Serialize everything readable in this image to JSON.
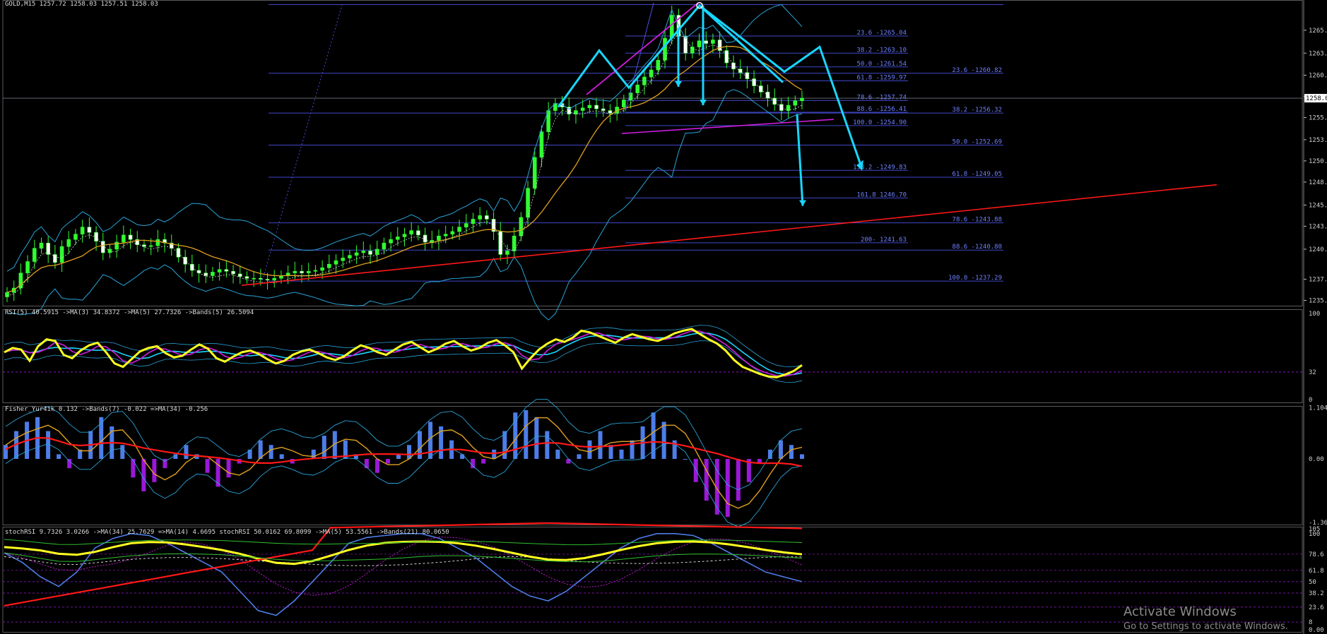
{
  "symbol_label": "GOLD,M15 1257.72 1258.03 1257.51 1258.03",
  "colors": {
    "background": "#000000",
    "grid": "#2b2f7a",
    "fib": "#3f48c8",
    "fib_text": "#6f80ff",
    "cyan": "#19d6ff",
    "magenta": "#d01ee0",
    "red": "#ff1818",
    "yellow": "#ffff20",
    "orange": "#e0a020",
    "blue_hist": "#4e7de8",
    "purple_hist": "#9a18d8",
    "price_axis": "#d0d0d0",
    "bull": "#30ff30",
    "bear": "#ffffff"
  },
  "price_panel": {
    "ylim": [
      1234.5,
      1268.8
    ],
    "axis_ticks": [
      "1265.7",
      "1263.1",
      "1260.6",
      "1258.2",
      "1255.8",
      "1253.3",
      "1250.9",
      "1248.5",
      "1245.9",
      "1243.5",
      "1240.9",
      "1237.5",
      "1235.1"
    ],
    "current_price": "1258.0",
    "fib_labels": [
      {
        "text": "23.6 -1265.04",
        "v": 1265.04
      },
      {
        "text": "38.2 -1263.10",
        "v": 1263.1
      },
      {
        "text": "50.0 -1261.54",
        "v": 1261.54
      },
      {
        "text": "61.8 -1259.97",
        "v": 1259.97
      },
      {
        "text": "78.6 -1257.74",
        "v": 1257.74
      },
      {
        "text": "88.6 -1256.41",
        "v": 1256.41
      },
      {
        "text": "100.0 -1254.90",
        "v": 1254.9
      },
      {
        "text": "138.2 -1249.83",
        "v": 1249.83
      },
      {
        "text": "161.8 1246.70",
        "v": 1246.7
      },
      {
        "text": "200- 1241.63",
        "v": 1241.63
      },
      {
        "text": "23.6 -1260.82",
        "v": 1260.82
      },
      {
        "text": "38.2 -1256.32",
        "v": 1256.32
      },
      {
        "text": "50.0 -1252.69",
        "v": 1252.69
      },
      {
        "text": "61.8 -1249.05",
        "v": 1249.05
      },
      {
        "text": "78.6 -1243.88",
        "v": 1243.88
      },
      {
        "text": "88.6 -1240.80",
        "v": 1240.8
      },
      {
        "text": "100.0 -1237.29",
        "v": 1237.29
      }
    ]
  },
  "rsi_panel": {
    "label": "RSI(5) 40.5915  ->MA(3) 34.8372  ->MA(5) 27.7326  ->Bands(5) 26.5094",
    "axis_ticks": [
      "100",
      "32",
      "0"
    ]
  },
  "fisher_panel": {
    "label": "Fisher_Yur4ik 0.132  ->Bands(7) -0.022  =>MA(34) -0.256",
    "axis_ticks": [
      "1.104",
      "0.00",
      "-1.369"
    ]
  },
  "stoch_panel": {
    "label": "stochRSI 9.7326 3.0266  ->MA(34) 25.7629  =>MA(14) 4.6695  stochRSI 50.0162 69.8099  ->MA(5) 53.5561  ->Bands(21) 80.0650",
    "axis_ticks": [
      "105",
      "100",
      "78.6",
      "61.8",
      "50",
      "38.2",
      "23.6",
      "8",
      "0.00"
    ]
  },
  "watermark": {
    "line1": "Activate Windows",
    "line2": "Go to Settings to activate Windows."
  },
  "chart_data": {
    "type": "line",
    "title": "",
    "xlabel": "",
    "ylabel": "",
    "ylim": [
      1234.5,
      1268.8
    ],
    "series": [
      {
        "values": [
          1236.0,
          1236.5,
          1238.2,
          1239.5,
          1241.0,
          1241.6,
          1240.3,
          1239.4,
          1241.2,
          1242.0,
          1242.6,
          1243.4,
          1242.8,
          1241.8,
          1240.5,
          1240.9,
          1241.7,
          1242.5,
          1242.0,
          1241.4,
          1241.2,
          1241.3,
          1242.0,
          1241.6,
          1241.0,
          1240.0,
          1239.2,
          1238.5,
          1238.2,
          1237.9,
          1238.3,
          1238.6,
          1238.4,
          1238.1,
          1237.8,
          1237.6,
          1237.6,
          1237.5,
          1237.4,
          1237.6,
          1237.9,
          1238.2,
          1238.4,
          1238.2,
          1238.4,
          1238.5,
          1238.8,
          1239.2,
          1239.6,
          1239.9,
          1240.2,
          1240.5,
          1240.7,
          1240.3,
          1240.9,
          1241.6,
          1242.0,
          1242.3,
          1242.6,
          1243.0,
          1242.5,
          1241.7,
          1241.9,
          1242.4,
          1242.6,
          1242.9,
          1243.4,
          1243.8,
          1244.3,
          1244.7,
          1244.3,
          1242.9,
          1240.3,
          1240.7,
          1242.4,
          1244.5,
          1247.8,
          1251.3,
          1254.2,
          1256.6,
          1257.4,
          1257.0,
          1256.2,
          1256.6,
          1256.9,
          1257.2,
          1256.8,
          1256.6,
          1256.3,
          1257.0,
          1257.8,
          1258.6,
          1259.5,
          1260.4,
          1261.2,
          1262.3,
          1264.8,
          1267.4,
          1265.0,
          1263.1,
          1263.8,
          1264.5,
          1264.2,
          1264.6,
          1263.4,
          1262.0,
          1261.3,
          1260.9,
          1260.2,
          1259.4,
          1258.7,
          1258.0,
          1257.3,
          1256.6,
          1257.2,
          1257.7,
          1258.0
        ]
      },
      {
        "values": [
          55,
          60,
          58,
          45,
          62,
          70,
          68,
          52,
          48,
          57,
          63,
          66,
          55,
          42,
          38,
          47,
          56,
          60,
          62,
          54,
          49,
          51,
          58,
          64,
          59,
          48,
          44,
          50,
          55,
          57,
          53,
          47,
          42,
          45,
          52,
          56,
          58,
          54,
          49,
          46,
          50,
          57,
          63,
          60,
          55,
          52,
          58,
          64,
          67,
          61,
          55,
          59,
          65,
          68,
          62,
          57,
          60,
          66,
          69,
          63,
          55,
          36,
          48,
          58,
          65,
          70,
          67,
          72,
          80,
          78,
          74,
          70,
          66,
          72,
          76,
          73,
          70,
          68,
          72,
          77,
          80,
          82,
          76,
          70,
          65,
          57,
          46,
          38,
          34,
          30,
          27,
          26,
          29,
          33,
          40
        ]
      },
      {
        "values": [
          0.3,
          0.6,
          0.8,
          0.9,
          0.6,
          0.1,
          -0.2,
          0.2,
          0.6,
          0.9,
          0.7,
          0.3,
          -0.4,
          -0.7,
          -0.5,
          -0.2,
          0.1,
          0.3,
          0.1,
          -0.3,
          -0.6,
          -0.4,
          -0.1,
          0.2,
          0.4,
          0.3,
          0.1,
          -0.1,
          0.0,
          0.2,
          0.5,
          0.6,
          0.4,
          0.1,
          -0.2,
          -0.3,
          -0.1,
          0.1,
          0.3,
          0.6,
          0.8,
          0.7,
          0.4,
          0.1,
          -0.2,
          -0.1,
          0.2,
          0.6,
          1.0,
          1.05,
          0.9,
          0.6,
          0.2,
          -0.1,
          0.1,
          0.4,
          0.6,
          0.3,
          0.2,
          0.4,
          0.7,
          1.0,
          0.8,
          0.4,
          0.0,
          -0.5,
          -0.9,
          -1.2,
          -1.25,
          -0.9,
          -0.5,
          -0.1,
          0.2,
          0.4,
          0.3,
          0.1
        ]
      },
      {
        "values": [
          80,
          70,
          55,
          45,
          60,
          85,
          95,
          100,
          98,
          90,
          80,
          70,
          60,
          40,
          20,
          15,
          30,
          50,
          70,
          90,
          96,
          98,
          100,
          100,
          95,
          85,
          75,
          60,
          45,
          35,
          30,
          40,
          55,
          70,
          85,
          95,
          100,
          100,
          98,
          90,
          80,
          70,
          60,
          55,
          50
        ]
      }
    ]
  }
}
